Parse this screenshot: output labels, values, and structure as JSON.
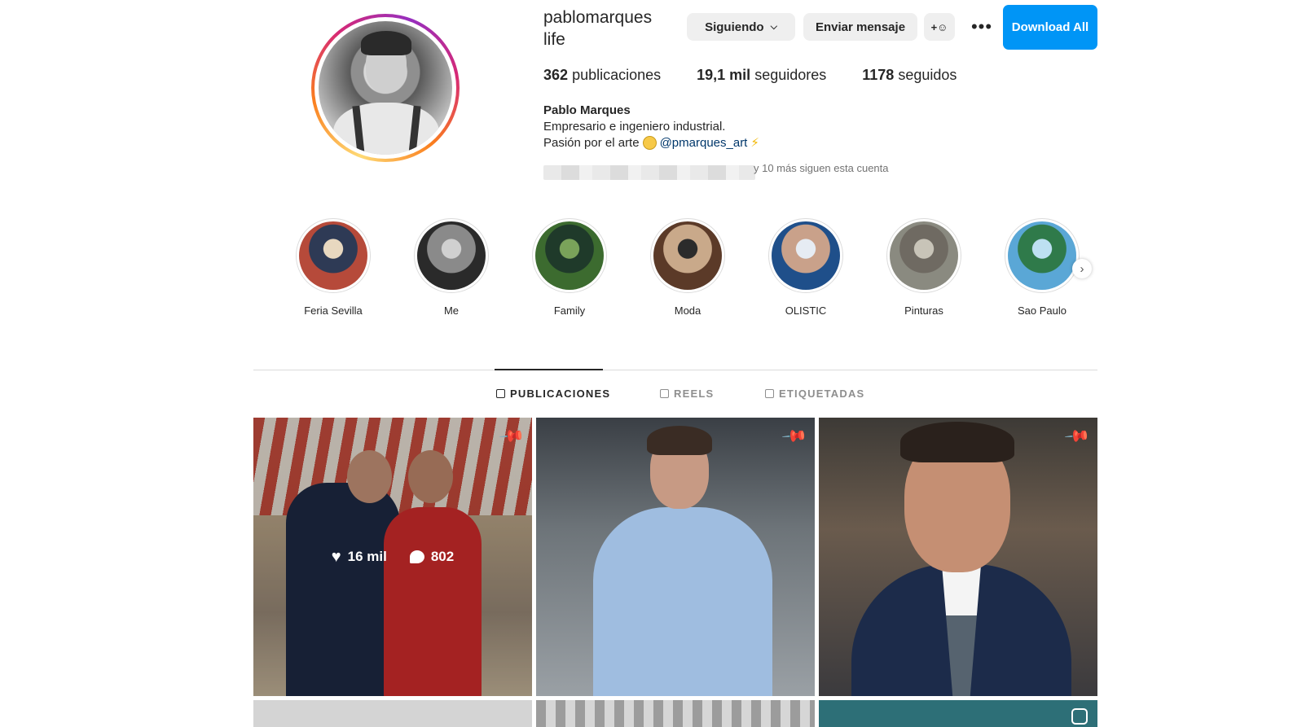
{
  "profile": {
    "username": "pablomarques life",
    "full_name": "Pablo Marques",
    "bio_line1": "Empresario e ingeniero industrial.",
    "bio_line2_prefix": "Pasión por el arte",
    "bio_mention": "@pmarques_art",
    "followed_by_text": "y 10 más siguen esta cuenta"
  },
  "actions": {
    "following_label": "Siguiendo",
    "message_label": "Enviar mensaje",
    "suggest_label": "+☺",
    "more_label": "•••",
    "download_label": "Download All"
  },
  "stats": {
    "posts_count": "362",
    "posts_label": "publicaciones",
    "followers_count": "19,1 mil",
    "followers_label": "seguidores",
    "following_count": "1178",
    "following_label": "seguidos"
  },
  "highlights": [
    {
      "label": "Feria Sevilla",
      "colors": [
        "#b64a3a",
        "#2e3a55",
        "#e8d8c0"
      ]
    },
    {
      "label": "Me",
      "colors": [
        "#2a2a2a",
        "#8a8a8a",
        "#d0d0d0"
      ]
    },
    {
      "label": "Family",
      "colors": [
        "#3c6b2f",
        "#1f3a2a",
        "#7aa35a"
      ]
    },
    {
      "label": "Moda",
      "colors": [
        "#5b3a28",
        "#c9a98a",
        "#2b2b2b"
      ]
    },
    {
      "label": "OLISTIC",
      "colors": [
        "#1f4f8a",
        "#c9a18a",
        "#e6ecf3"
      ]
    },
    {
      "label": "Pinturas",
      "colors": [
        "#8a8a80",
        "#6f6a62",
        "#c8c4b8"
      ]
    },
    {
      "label": "Sao Paulo",
      "colors": [
        "#5aa7d6",
        "#2f7a4a",
        "#bde0f2"
      ]
    }
  ],
  "tabs": [
    {
      "label": "PUBLICACIONES",
      "active": true
    },
    {
      "label": "REELS",
      "active": false
    },
    {
      "label": "ETIQUETADAS",
      "active": false
    }
  ],
  "posts": {
    "first": {
      "likes": "16 mil",
      "comments": "802"
    }
  },
  "colors": {
    "accent": "#0095f6",
    "text": "#262626",
    "muted": "#737373",
    "button_bg": "#efefef"
  }
}
